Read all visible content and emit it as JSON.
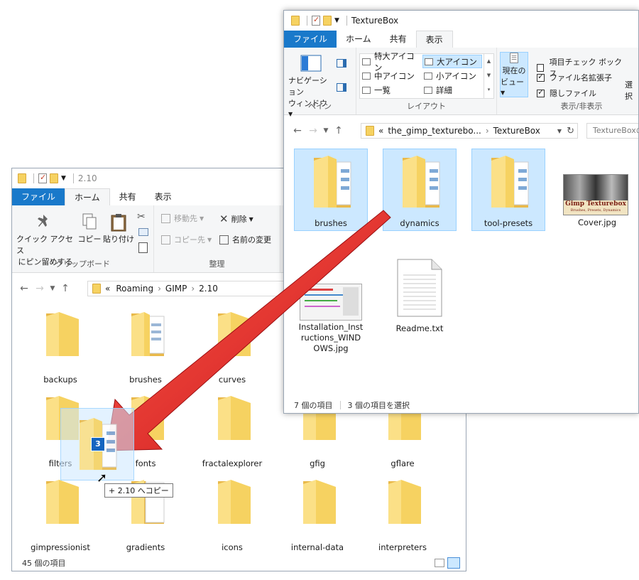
{
  "back_window": {
    "title": "2.10",
    "tabs": [
      "ファイル",
      "ホーム",
      "共有",
      "表示"
    ],
    "ribbon": {
      "pin_label_1": "クイック アクセス",
      "pin_label_2": "にピン留めする",
      "copy_label": "コピー",
      "paste_label": "貼り付け",
      "move_label": "移動先",
      "copyto_label": "コピー先",
      "delete_label": "削除",
      "rename_label": "名前の変更",
      "group_clipboard": "クリップボード",
      "group_organize": "整理"
    },
    "breadcrumb": [
      "«",
      "Roaming",
      "GIMP",
      "2.10"
    ],
    "items": [
      "backups",
      "brushes",
      "curves",
      "filters",
      "fonts",
      "fractalexplorer",
      "gfig",
      "gflare",
      "gimpressionist",
      "gradients",
      "icons",
      "internal-data",
      "interpreters"
    ],
    "status": "45 個の項目"
  },
  "front_window": {
    "title": "TextureBox",
    "tabs": [
      "ファイル",
      "ホーム",
      "共有",
      "表示"
    ],
    "ribbon": {
      "pane_label_1": "ナビゲーション",
      "pane_label_2": "ウィンドウ",
      "group_pane": "ペイン",
      "layout": [
        "特大アイコン",
        "大アイコン",
        "中アイコン",
        "小アイコン",
        "一覧",
        "詳細"
      ],
      "group_layout": "レイアウト",
      "current_view_1": "現在の",
      "current_view_2": "ビュー",
      "opt_item_check": "項目チェック ボックス",
      "opt_ext": "ファイル名拡張子",
      "opt_hidden": "隠しファイル",
      "group_showhide": "表示/非表示",
      "select_cut": "選択"
    },
    "breadcrumb": [
      "«",
      "the_gimp_texturebo...",
      "TextureBox"
    ],
    "search_placeholder": "TextureBoxの",
    "items": {
      "brushes": "brushes",
      "dynamics": "dynamics",
      "tool_presets": "tool-presets",
      "cover": "Cover.jpg",
      "cover_thumb_title": "Gimp Texturebox",
      "cover_thumb_sub": "Brushes, Presets, Dynamics",
      "install": "Installation_Instructions_WINDOWS.jpg",
      "readme": "Readme.txt"
    },
    "status_count": "7 個の項目",
    "status_selected": "3 個の項目を選択"
  },
  "drag": {
    "count": "3",
    "tooltip": "+ 2.10 へコピー"
  },
  "colors": {
    "accent": "#1979ca",
    "selection": "#cce8ff",
    "arrow": "#e02020",
    "folder": "#f6d261"
  }
}
